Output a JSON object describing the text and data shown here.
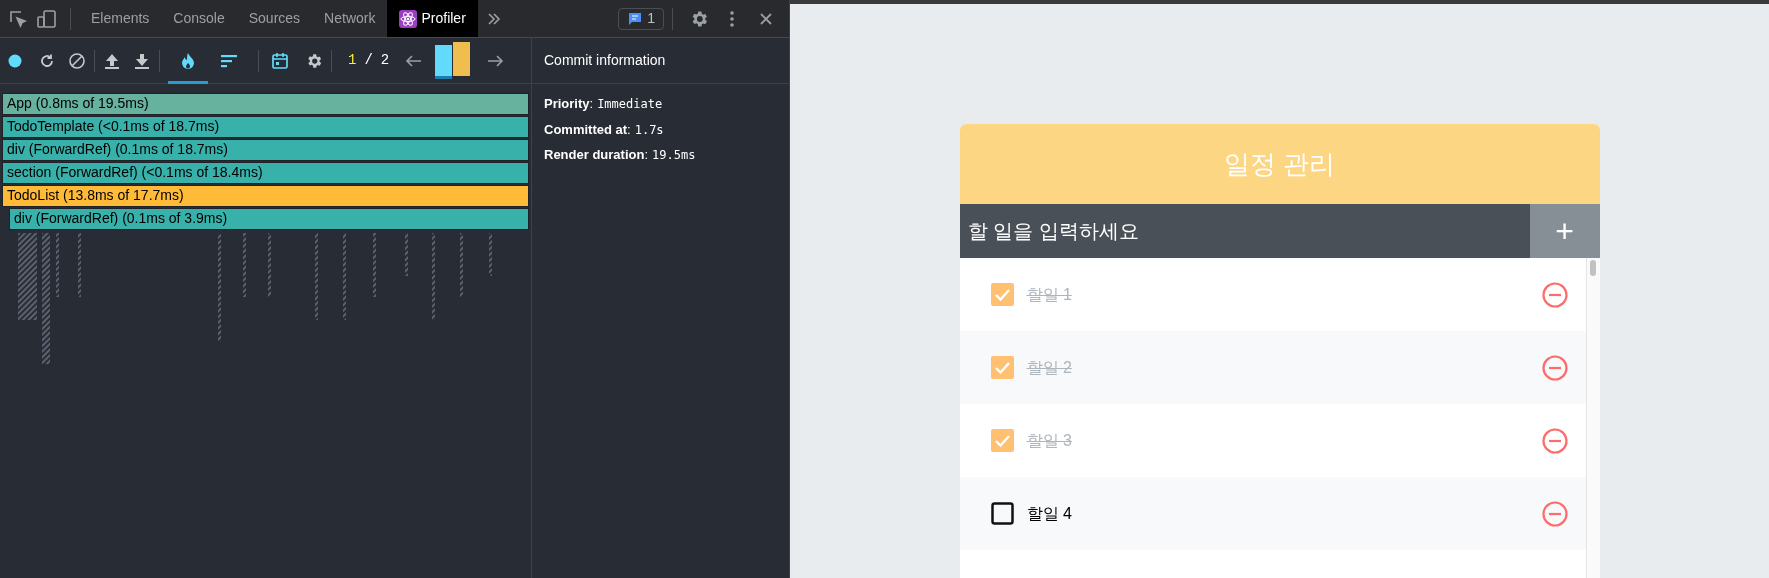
{
  "devtools": {
    "tabs": [
      {
        "label": "Elements",
        "selected": false
      },
      {
        "label": "Console",
        "selected": false
      },
      {
        "label": "Sources",
        "selected": false
      },
      {
        "label": "Network",
        "selected": false
      },
      {
        "label": "Profiler",
        "selected": true
      }
    ],
    "issues_count": "1"
  },
  "profiler": {
    "view_modes": [
      {
        "kind": "flamegraph",
        "selected": true
      },
      {
        "kind": "ranked",
        "selected": false
      }
    ],
    "commit_index": "1",
    "commit_separator": "/",
    "commit_total": "2",
    "commits": [
      {
        "color": "#61dafb",
        "selected": true
      },
      {
        "color": "#f0bd4f",
        "selected": false
      }
    ],
    "flamegraph": [
      {
        "label": "App (0.8ms of 19.5ms)",
        "color": "#67b19f"
      },
      {
        "label": "TodoTemplate (<0.1ms of 18.7ms)",
        "color": "#37b1a9"
      },
      {
        "label": "div (ForwardRef) (0.1ms of 18.7ms)",
        "color": "#37b1a9"
      },
      {
        "label": "section (ForwardRef) (<0.1ms of 18.4ms)",
        "color": "#37b1a9"
      },
      {
        "label": "TodoList (13.8ms of 17.7ms)",
        "color": "#ffbb38"
      },
      {
        "label": "div (ForwardRef) (0.1ms of 3.9ms)",
        "color": "#37b1a9"
      }
    ],
    "commit_info": {
      "title": "Commit information",
      "fields": [
        {
          "label": "**Priority**:",
          "value": "Immediate"
        },
        {
          "label": "**Committed at**:",
          "value": "1.7s"
        },
        {
          "label": "**Render duration**:",
          "value": "19.5ms"
        }
      ]
    }
  },
  "app": {
    "title": "일정 관리",
    "input": {
      "placeholder": "할 일을 입력하세요"
    },
    "add_button": "+",
    "todos": [
      {
        "text": "할일 1",
        "checked": true
      },
      {
        "text": "할일 2",
        "checked": true
      },
      {
        "text": "할일 3",
        "checked": true
      },
      {
        "text": "할일 4",
        "checked": false
      }
    ]
  }
}
